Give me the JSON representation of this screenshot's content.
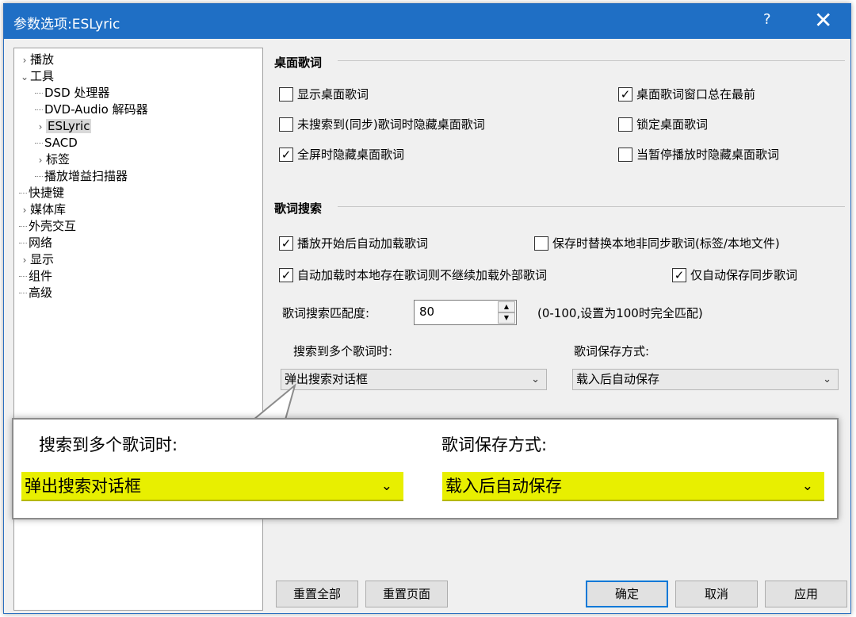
{
  "window": {
    "title": "参数选项:ESLyric",
    "help": "?",
    "close": "✕"
  },
  "tree": [
    {
      "label": "播放",
      "exp": "›"
    },
    {
      "label": "工具",
      "exp": "⌄"
    },
    {
      "label": "DSD 处理器",
      "exp": ""
    },
    {
      "label": "DVD-Audio 解码器",
      "exp": ""
    },
    {
      "label": "ESLyric",
      "exp": "›"
    },
    {
      "label": "SACD",
      "exp": ""
    },
    {
      "label": "标签",
      "exp": "›"
    },
    {
      "label": "播放增益扫描器",
      "exp": ""
    },
    {
      "label": "快捷键",
      "exp": ""
    },
    {
      "label": "媒体库",
      "exp": "›"
    },
    {
      "label": "外壳交互",
      "exp": ""
    },
    {
      "label": "网络",
      "exp": ""
    },
    {
      "label": "显示",
      "exp": "›"
    },
    {
      "label": "组件",
      "exp": ""
    },
    {
      "label": "高级",
      "exp": ""
    }
  ],
  "desktop": {
    "title": "桌面歌词",
    "options": [
      {
        "label": "显示桌面歌词",
        "checked": false
      },
      {
        "label": "桌面歌词窗口总在最前",
        "checked": true
      },
      {
        "label": "未搜索到(同步)歌词时隐藏桌面歌词",
        "checked": false
      },
      {
        "label": "锁定桌面歌词",
        "checked": false
      },
      {
        "label": "全屏时隐藏桌面歌词",
        "checked": true
      },
      {
        "label": "当暂停播放时隐藏桌面歌词",
        "checked": false
      }
    ]
  },
  "search": {
    "title": "歌词搜索",
    "options": [
      {
        "label": "播放开始后自动加载歌词",
        "checked": true
      },
      {
        "label": "保存时替换本地非同步歌词(标签/本地文件)",
        "checked": false
      },
      {
        "label": "自动加载时本地存在歌词则不继续加载外部歌词",
        "checked": true
      },
      {
        "label": "仅自动保存同步歌词",
        "checked": true
      }
    ],
    "match_label": "歌词搜索匹配度:",
    "match_value": "80",
    "match_hint": "(0-100,设置为100时完全匹配)",
    "multi_label": "搜索到多个歌词时:",
    "multi_value": "弹出搜索对话框",
    "save_label": "歌词保存方式:",
    "save_value": "载入后自动保存"
  },
  "buttons": {
    "reset_all": "重置全部",
    "reset_page": "重置页面",
    "ok": "确定",
    "cancel": "取消",
    "apply": "应用"
  },
  "colors": {
    "titlebar": "#1f6fc5",
    "highlight": "#e8ef00",
    "accent": "#0078d7"
  }
}
